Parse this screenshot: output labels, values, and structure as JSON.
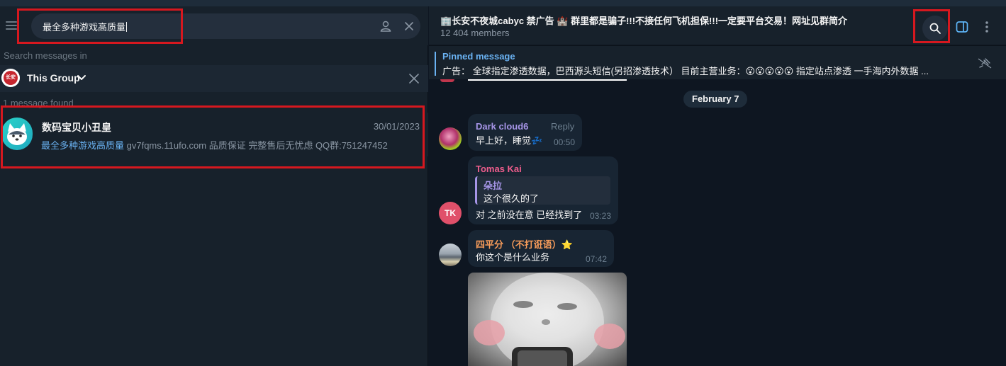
{
  "search": {
    "query": "最全多种游戏高质量",
    "scope_label": "Search messages in",
    "scope_group": "This Group",
    "results_count": "1 message found"
  },
  "result": {
    "name": "数码宝贝小丑皇",
    "date": "30/01/2023",
    "snippet_highlight": "最全多种游戏高质量",
    "snippet_rest": " gv7fqms.11ufo.com  品质保证 完整售后无忧虑 QQ群:751247452"
  },
  "chat": {
    "title": "🏢长安不夜城cabyc 禁广告 🏰 群里都是骗子!!!不接任何飞机担保!!!一定要平台交易！网址见群简介",
    "members": "12 404 members",
    "pinned_label": "Pinned message",
    "pinned_text": "广告：  全球指定渗透数据，巴西源头短信(另招渗透技术）  目前主营业务：😮😮😮😮😮 指定站点渗透  一手海内外数据  ..."
  },
  "messages": {
    "date_chip": "February 7",
    "m1": {
      "sender": "Dark cloud6",
      "reply": "Reply",
      "text": "早上好，睡觉💤",
      "time": "00:50"
    },
    "m2": {
      "sender": "Tomas Kai",
      "avatar_initials": "TK",
      "quote_author": "朵拉",
      "quote_text": "这个很久的了",
      "text": "对 之前没在意 已经找到了",
      "time": "03:23"
    },
    "m3": {
      "sender": "四平分 （不打诳语）⭐",
      "text": "你这个是什么业务",
      "time": "07:42"
    }
  },
  "colors": {
    "accent": "#6ab2f2",
    "highlight_box": "#d6181f",
    "sender_purple": "#a695e7",
    "sender_pink": "#ee5d8c",
    "sender_orange": "#f89c5a"
  },
  "icons": [
    "menu-icon",
    "user-icon",
    "close-icon",
    "chevron-down-icon",
    "search-icon",
    "sidebar-toggle-icon",
    "more-vertical-icon",
    "unpin-icon"
  ]
}
